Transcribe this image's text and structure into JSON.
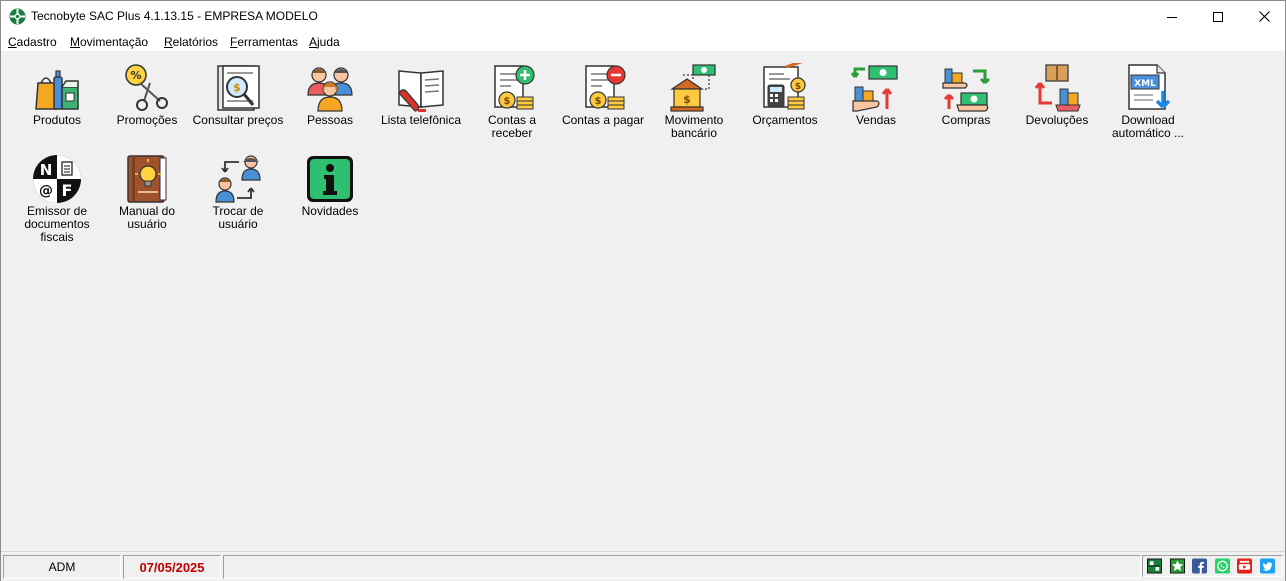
{
  "window": {
    "title": "Tecnobyte SAC Plus 4.1.13.15 - EMPRESA MODELO",
    "logo_icon": "tecnobyte-logo-icon",
    "controls": [
      "minimize-icon",
      "maximize-icon",
      "close-icon"
    ]
  },
  "menu": [
    {
      "label": "Cadastro",
      "access_key": "C",
      "rest": "adastro"
    },
    {
      "label": "Movimentação",
      "access_key": "M",
      "rest": "ovimentação"
    },
    {
      "label": "Relatórios",
      "access_key": "R",
      "rest": "elatórios"
    },
    {
      "label": "Ferramentas",
      "access_key": "F",
      "rest": "erramentas"
    },
    {
      "label": "Ajuda",
      "access_key": "A",
      "rest": "juda"
    }
  ],
  "shortcuts": [
    {
      "label": "Produtos",
      "icon": "products-icon"
    },
    {
      "label": "Promoções",
      "icon": "promotions-icon"
    },
    {
      "label": "Consultar preços",
      "icon": "price-check-icon"
    },
    {
      "label": "Pessoas",
      "icon": "people-icon"
    },
    {
      "label": "Lista telefônica",
      "icon": "phone-book-icon"
    },
    {
      "label": "Contas a receber",
      "icon": "receivables-icon"
    },
    {
      "label": "Contas a pagar",
      "icon": "payables-icon"
    },
    {
      "label": "Movimento bancário",
      "icon": "bank-icon"
    },
    {
      "label": "Orçamentos",
      "icon": "quotes-icon"
    },
    {
      "label": "Vendas",
      "icon": "sales-icon"
    },
    {
      "label": "Compras",
      "icon": "purchases-icon"
    },
    {
      "label": "Devoluções",
      "icon": "returns-icon"
    },
    {
      "label": "Download automático ...",
      "icon": "xml-download-icon"
    },
    {
      "label": "Emissor de documentos fiscais",
      "icon": "nfe-issuer-icon"
    },
    {
      "label": "Manual do usuário",
      "icon": "user-manual-icon"
    },
    {
      "label": "Trocar de usuário",
      "icon": "switch-user-icon"
    },
    {
      "label": "Novidades",
      "icon": "news-info-icon"
    }
  ],
  "status": {
    "user": "ADM",
    "date": "07/05/2025",
    "social_icons": [
      "tecnobyte-app-icon",
      "star-icon",
      "facebook-icon",
      "whatsapp-icon",
      "youtube-icon",
      "twitter-icon"
    ]
  },
  "colors": {
    "date": "#c00000",
    "facebook": "#3b5998",
    "whatsapp": "#25d366",
    "youtube": "#e62117",
    "twitter": "#1da1f2",
    "info_green": "#2fbf71"
  }
}
